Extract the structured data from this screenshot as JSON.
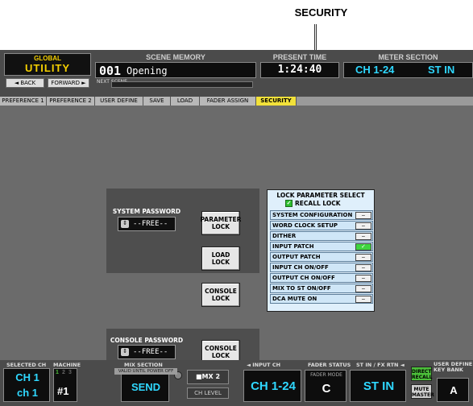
{
  "callout": {
    "label": "SECURITY"
  },
  "header": {
    "global": "GLOBAL",
    "utility": "UTILITY",
    "back": "◄ BACK",
    "forward": "FORWARD ►",
    "scene_memory": "SCENE MEMORY",
    "scene_number": "001",
    "scene_name": "Opening",
    "next_scene": "NEXT SCENE",
    "present_time_label": "PRESENT TIME",
    "present_time": "1:24:40",
    "meter_section": "METER SECTION",
    "meter_channels": "CH 1-24",
    "meter_st": "ST IN"
  },
  "tabs": [
    {
      "label": "PREFERENCE 1"
    },
    {
      "label": "PREFERENCE 2"
    },
    {
      "label": "USER DEFINE"
    },
    {
      "label": "SAVE"
    },
    {
      "label": "LOAD"
    },
    {
      "label": "FADER ASSIGN"
    },
    {
      "label": "SECURITY"
    }
  ],
  "system_password": {
    "label": "SYSTEM PASSWORD",
    "value": "--FREE--",
    "parameter_lock": "PARAMETER LOCK",
    "load_lock": "LOAD LOCK",
    "console_lock": "CONSOLE LOCK"
  },
  "console_password": {
    "label": "CONSOLE PASSWORD",
    "value": "--FREE--",
    "console_lock": "CONSOLE LOCK",
    "note": "VALID UNTIL POWER OFF"
  },
  "lock_parameter": {
    "title": "LOCK PARAMETER SELECT",
    "recall_lock": "RECALL LOCK",
    "recall_checked": true,
    "items": [
      {
        "label": "SYSTEM CONFIGURATION",
        "state": "–"
      },
      {
        "label": "WORD CLOCK SETUP",
        "state": "–"
      },
      {
        "label": "DITHER",
        "state": "–"
      },
      {
        "label": "INPUT PATCH",
        "state": "✓"
      },
      {
        "label": "OUTPUT PATCH",
        "state": "–"
      },
      {
        "label": "INPUT CH ON/OFF",
        "state": "–"
      },
      {
        "label": "OUTPUT CH ON/OFF",
        "state": "–"
      },
      {
        "label": "MIX TO ST ON/OFF",
        "state": "–"
      },
      {
        "label": "DCA MUTE ON",
        "state": "–"
      }
    ]
  },
  "bottom": {
    "selected_ch_label": "SELECTED CH",
    "selected_ch": "CH 1",
    "selected_ch_name": "ch 1",
    "machine_id_label": "MACHINE ID",
    "machine_id": "#1",
    "machine_nums": [
      "1",
      "2",
      "3"
    ],
    "mix_section_label": "MIX SECTION",
    "mix_send": "SEND",
    "mix_ch": "■MX 2",
    "ch_level": "CH LEVEL",
    "input_ch_label": "◄ INPUT CH",
    "input_ch": "CH 1-24",
    "fader_status_label": "FADER STATUS",
    "fader_mode_label": "FADER MODE",
    "fader_mode": "C",
    "st_in_label": "ST IN / FX RTN ◄",
    "st_in": "ST IN",
    "direct_recall": "DIRECT RECALL",
    "mute_master": "MUTE MASTER",
    "user_def_key_bank": "USER DEFINE KEY BANK",
    "user_def_value": "A"
  }
}
